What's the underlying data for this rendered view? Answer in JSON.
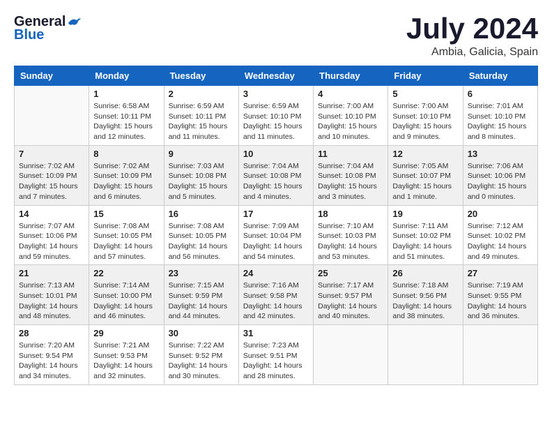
{
  "header": {
    "logo_general": "General",
    "logo_blue": "Blue",
    "month_title": "July 2024",
    "subtitle": "Ambia, Galicia, Spain"
  },
  "calendar": {
    "days_of_week": [
      "Sunday",
      "Monday",
      "Tuesday",
      "Wednesday",
      "Thursday",
      "Friday",
      "Saturday"
    ],
    "weeks": [
      [
        {
          "day": "",
          "info": ""
        },
        {
          "day": "1",
          "info": "Sunrise: 6:58 AM\nSunset: 10:11 PM\nDaylight: 15 hours\nand 12 minutes."
        },
        {
          "day": "2",
          "info": "Sunrise: 6:59 AM\nSunset: 10:11 PM\nDaylight: 15 hours\nand 11 minutes."
        },
        {
          "day": "3",
          "info": "Sunrise: 6:59 AM\nSunset: 10:10 PM\nDaylight: 15 hours\nand 11 minutes."
        },
        {
          "day": "4",
          "info": "Sunrise: 7:00 AM\nSunset: 10:10 PM\nDaylight: 15 hours\nand 10 minutes."
        },
        {
          "day": "5",
          "info": "Sunrise: 7:00 AM\nSunset: 10:10 PM\nDaylight: 15 hours\nand 9 minutes."
        },
        {
          "day": "6",
          "info": "Sunrise: 7:01 AM\nSunset: 10:10 PM\nDaylight: 15 hours\nand 8 minutes."
        }
      ],
      [
        {
          "day": "7",
          "info": "Sunrise: 7:02 AM\nSunset: 10:09 PM\nDaylight: 15 hours\nand 7 minutes."
        },
        {
          "day": "8",
          "info": "Sunrise: 7:02 AM\nSunset: 10:09 PM\nDaylight: 15 hours\nand 6 minutes."
        },
        {
          "day": "9",
          "info": "Sunrise: 7:03 AM\nSunset: 10:08 PM\nDaylight: 15 hours\nand 5 minutes."
        },
        {
          "day": "10",
          "info": "Sunrise: 7:04 AM\nSunset: 10:08 PM\nDaylight: 15 hours\nand 4 minutes."
        },
        {
          "day": "11",
          "info": "Sunrise: 7:04 AM\nSunset: 10:08 PM\nDaylight: 15 hours\nand 3 minutes."
        },
        {
          "day": "12",
          "info": "Sunrise: 7:05 AM\nSunset: 10:07 PM\nDaylight: 15 hours\nand 1 minute."
        },
        {
          "day": "13",
          "info": "Sunrise: 7:06 AM\nSunset: 10:06 PM\nDaylight: 15 hours\nand 0 minutes."
        }
      ],
      [
        {
          "day": "14",
          "info": "Sunrise: 7:07 AM\nSunset: 10:06 PM\nDaylight: 14 hours\nand 59 minutes."
        },
        {
          "day": "15",
          "info": "Sunrise: 7:08 AM\nSunset: 10:05 PM\nDaylight: 14 hours\nand 57 minutes."
        },
        {
          "day": "16",
          "info": "Sunrise: 7:08 AM\nSunset: 10:05 PM\nDaylight: 14 hours\nand 56 minutes."
        },
        {
          "day": "17",
          "info": "Sunrise: 7:09 AM\nSunset: 10:04 PM\nDaylight: 14 hours\nand 54 minutes."
        },
        {
          "day": "18",
          "info": "Sunrise: 7:10 AM\nSunset: 10:03 PM\nDaylight: 14 hours\nand 53 minutes."
        },
        {
          "day": "19",
          "info": "Sunrise: 7:11 AM\nSunset: 10:02 PM\nDaylight: 14 hours\nand 51 minutes."
        },
        {
          "day": "20",
          "info": "Sunrise: 7:12 AM\nSunset: 10:02 PM\nDaylight: 14 hours\nand 49 minutes."
        }
      ],
      [
        {
          "day": "21",
          "info": "Sunrise: 7:13 AM\nSunset: 10:01 PM\nDaylight: 14 hours\nand 48 minutes."
        },
        {
          "day": "22",
          "info": "Sunrise: 7:14 AM\nSunset: 10:00 PM\nDaylight: 14 hours\nand 46 minutes."
        },
        {
          "day": "23",
          "info": "Sunrise: 7:15 AM\nSunset: 9:59 PM\nDaylight: 14 hours\nand 44 minutes."
        },
        {
          "day": "24",
          "info": "Sunrise: 7:16 AM\nSunset: 9:58 PM\nDaylight: 14 hours\nand 42 minutes."
        },
        {
          "day": "25",
          "info": "Sunrise: 7:17 AM\nSunset: 9:57 PM\nDaylight: 14 hours\nand 40 minutes."
        },
        {
          "day": "26",
          "info": "Sunrise: 7:18 AM\nSunset: 9:56 PM\nDaylight: 14 hours\nand 38 minutes."
        },
        {
          "day": "27",
          "info": "Sunrise: 7:19 AM\nSunset: 9:55 PM\nDaylight: 14 hours\nand 36 minutes."
        }
      ],
      [
        {
          "day": "28",
          "info": "Sunrise: 7:20 AM\nSunset: 9:54 PM\nDaylight: 14 hours\nand 34 minutes."
        },
        {
          "day": "29",
          "info": "Sunrise: 7:21 AM\nSunset: 9:53 PM\nDaylight: 14 hours\nand 32 minutes."
        },
        {
          "day": "30",
          "info": "Sunrise: 7:22 AM\nSunset: 9:52 PM\nDaylight: 14 hours\nand 30 minutes."
        },
        {
          "day": "31",
          "info": "Sunrise: 7:23 AM\nSunset: 9:51 PM\nDaylight: 14 hours\nand 28 minutes."
        },
        {
          "day": "",
          "info": ""
        },
        {
          "day": "",
          "info": ""
        },
        {
          "day": "",
          "info": ""
        }
      ]
    ]
  }
}
